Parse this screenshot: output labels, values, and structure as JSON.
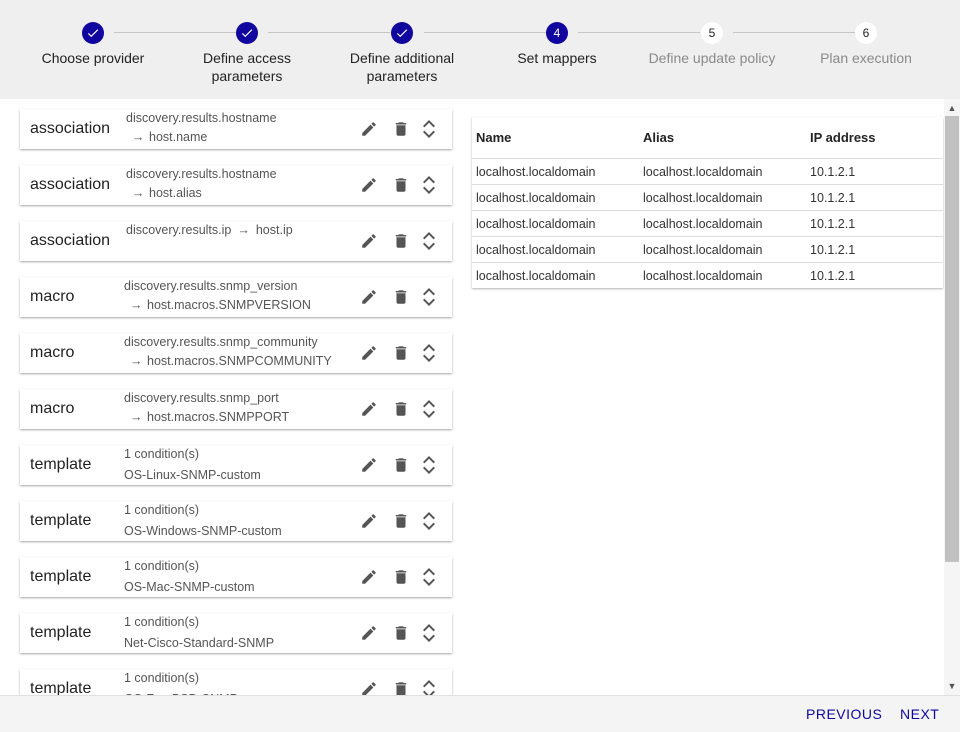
{
  "steps": [
    {
      "label": "Choose provider",
      "number": "1",
      "state": "done"
    },
    {
      "label": "Define access parameters",
      "number": "2",
      "state": "done"
    },
    {
      "label": "Define additional parameters",
      "number": "3",
      "state": "done"
    },
    {
      "label": "Set mappers",
      "number": "4",
      "state": "active"
    },
    {
      "label": "Define update policy",
      "number": "5",
      "state": "pending"
    },
    {
      "label": "Plan execution",
      "number": "6",
      "state": "pending"
    }
  ],
  "mappers": [
    {
      "type": "association",
      "line1": "discovery.results.hostname",
      "line2": "host.name",
      "layout": "two-line"
    },
    {
      "type": "association",
      "line1": "discovery.results.hostname",
      "line2": "host.alias",
      "layout": "two-line"
    },
    {
      "type": "association",
      "line1": "discovery.results.ip",
      "line2": "host.ip",
      "layout": "inline"
    },
    {
      "type": "macro",
      "line1": "discovery.results.snmp_version",
      "line2": "host.macros.SNMPVERSION",
      "layout": "two-line"
    },
    {
      "type": "macro",
      "line1": "discovery.results.snmp_community",
      "line2": "host.macros.SNMPCOMMUNITY",
      "layout": "two-line"
    },
    {
      "type": "macro",
      "line1": "discovery.results.snmp_port",
      "line2": "host.macros.SNMPPORT",
      "layout": "two-line"
    },
    {
      "type": "template",
      "line1": "1 condition(s)",
      "line2": "OS-Linux-SNMP-custom",
      "layout": "plain"
    },
    {
      "type": "template",
      "line1": "1 condition(s)",
      "line2": "OS-Windows-SNMP-custom",
      "layout": "plain"
    },
    {
      "type": "template",
      "line1": "1 condition(s)",
      "line2": "OS-Mac-SNMP-custom",
      "layout": "plain"
    },
    {
      "type": "template",
      "line1": "1 condition(s)",
      "line2": "Net-Cisco-Standard-SNMP",
      "layout": "plain"
    },
    {
      "type": "template",
      "line1": "1 condition(s)",
      "line2": "OS-FreeBSD-SNMP",
      "layout": "plain"
    }
  ],
  "table": {
    "columns": [
      "Name",
      "Alias",
      "IP address"
    ],
    "rows": [
      [
        "localhost.localdomain",
        "localhost.localdomain",
        "10.1.2.1"
      ],
      [
        "localhost.localdomain",
        "localhost.localdomain",
        "10.1.2.1"
      ],
      [
        "localhost.localdomain",
        "localhost.localdomain",
        "10.1.2.1"
      ],
      [
        "localhost.localdomain",
        "localhost.localdomain",
        "10.1.2.1"
      ],
      [
        "localhost.localdomain",
        "localhost.localdomain",
        "10.1.2.1"
      ]
    ]
  },
  "footer": {
    "previous_label": "PREVIOUS",
    "next_label": "NEXT"
  },
  "colors": {
    "accent": "#10069f"
  }
}
